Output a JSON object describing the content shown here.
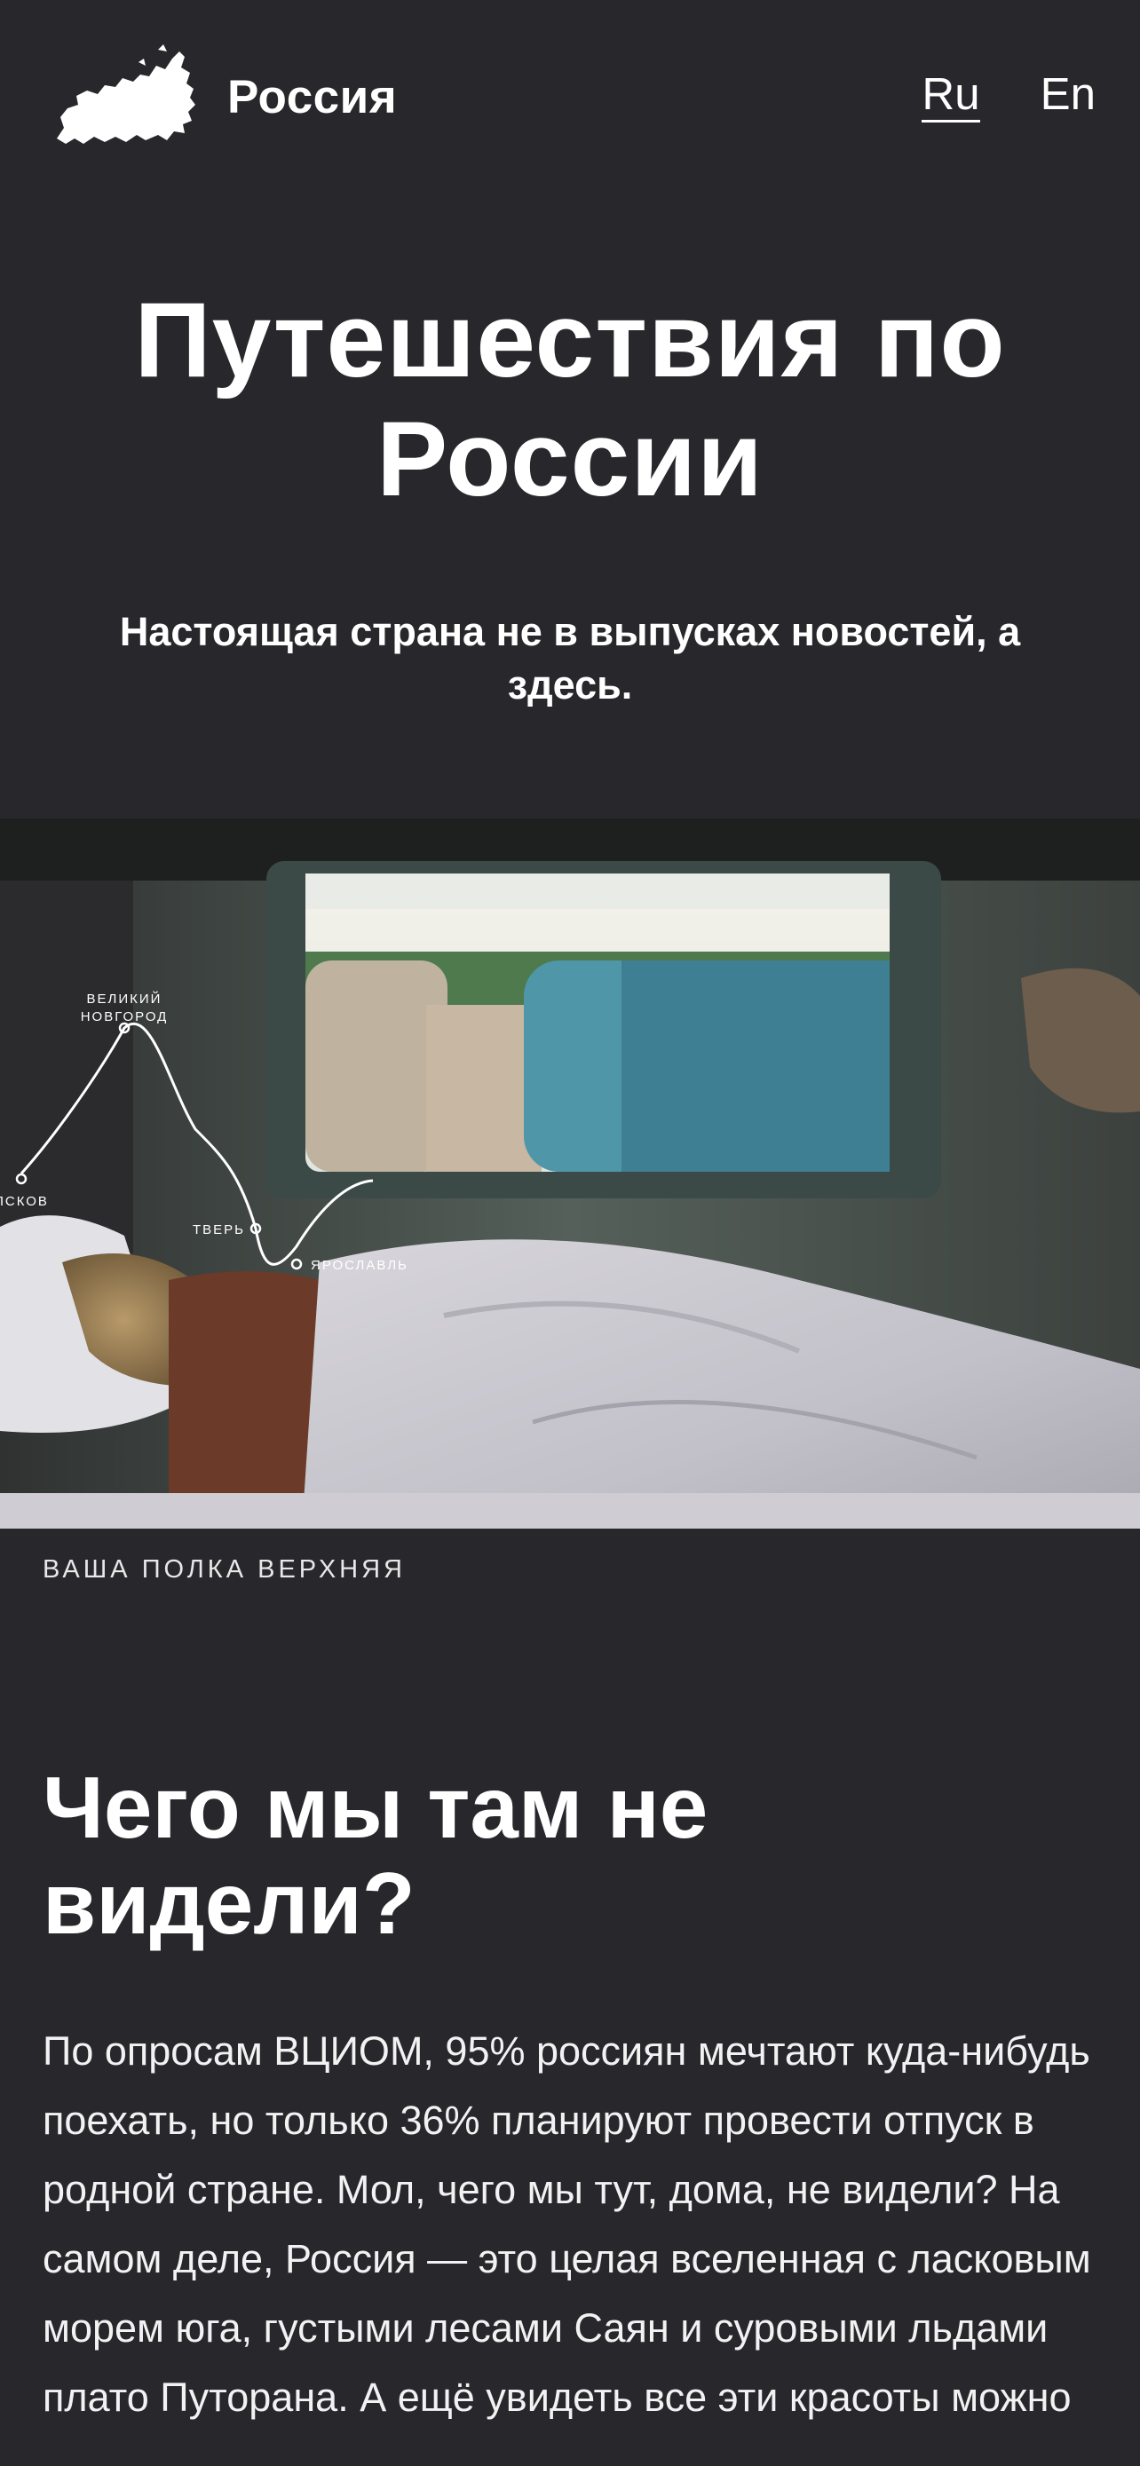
{
  "header": {
    "logo_text": "Россия",
    "languages": [
      {
        "label": "Ru",
        "active": true
      },
      {
        "label": "En",
        "active": false
      }
    ]
  },
  "hero": {
    "title": "Путешествия по России",
    "subtitle": "Настоящая страна не в выпусках новостей, а здесь."
  },
  "photo": {
    "route_labels": {
      "velikiy": "ВЕЛИКИЙ",
      "novgorod": "НОВГОРОД",
      "pskov": "ПСКОВ",
      "tver": "ТВЕРЬ",
      "yaroslavl": "ЯРОСЛАВЛЬ"
    },
    "caption": "ВАША ПОЛКА ВЕРХНЯЯ"
  },
  "section": {
    "title": "Чего мы там не видели?",
    "body": "По опросам ВЦИОМ, 95% россиян мечтают куда-нибудь поехать, но только 36% планируют провести отпуск в родной стране. Мол, чего мы тут, дома, не видели? На самом деле, Россия — это целая вселенная с ласковым морем юга, густыми лесами Саян и суровыми льдами плато Путорана. А ещё увидеть все эти красоты можно"
  },
  "colors": {
    "background": "#28282c",
    "text": "#ffffff"
  }
}
